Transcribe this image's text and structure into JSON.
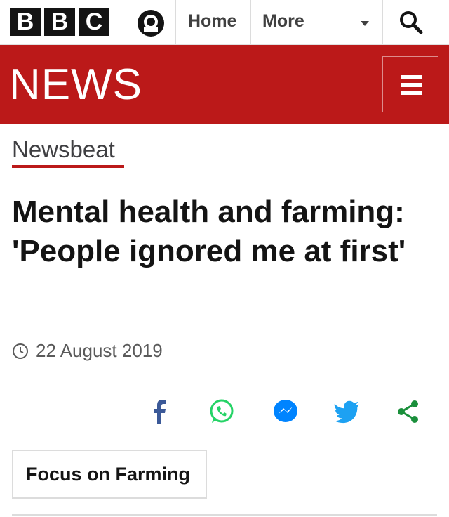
{
  "brand": {
    "letters": [
      "B",
      "B",
      "C"
    ]
  },
  "nav": {
    "home_label": "Home",
    "more_label": "More"
  },
  "header": {
    "title": "NEWS"
  },
  "section": {
    "label": "Newsbeat"
  },
  "article": {
    "headline": "Mental health and farming: 'People ignored me at first'",
    "date": "22 August 2019",
    "tag": "Focus on Farming"
  },
  "share": {
    "icons": [
      "facebook-icon",
      "whatsapp-icon",
      "messenger-icon",
      "twitter-icon",
      "share-icon"
    ]
  },
  "colors": {
    "brand_red": "#bb1919",
    "facebook": "#3b5998",
    "whatsapp": "#25d366",
    "messenger": "#0084ff",
    "twitter": "#1da1f2",
    "share": "#1a8f3b"
  }
}
